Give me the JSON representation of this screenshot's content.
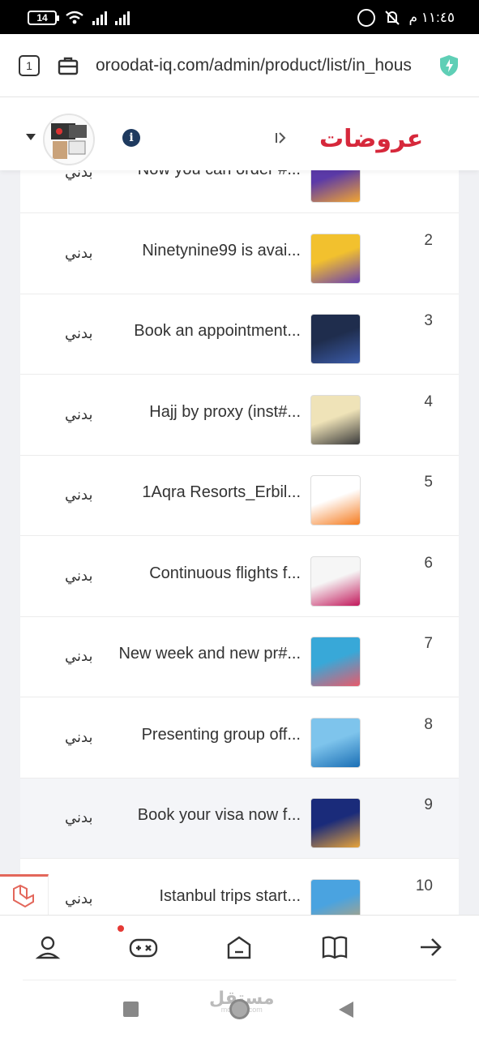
{
  "status_bar": {
    "battery": "14",
    "time": "١١:٤٥ م"
  },
  "browser": {
    "tab_count": "1",
    "url": "oroodat-iq.com/admin/product/list/in_hous"
  },
  "app": {
    "logo_text": "عروضات",
    "brand_color": "#d6283b"
  },
  "products": [
    {
      "num": "",
      "title": "Now you can order #...",
      "category": "بدني",
      "thumb_colors": [
        "#5b3aa8",
        "#f2a531"
      ]
    },
    {
      "num": "2",
      "title": "Ninetynine99 is avai...",
      "category": "بدني",
      "thumb_colors": [
        "#f2c12e",
        "#6a3fb0"
      ]
    },
    {
      "num": "3",
      "title": "Book an appointment...",
      "category": "بدني",
      "thumb_colors": [
        "#1f2d4d",
        "#3b5ba8"
      ]
    },
    {
      "num": "4",
      "title": "Hajj by proxy (inst#...",
      "category": "بدني",
      "thumb_colors": [
        "#efe3b8",
        "#3a3a3a"
      ]
    },
    {
      "num": "5",
      "title": "1Aqra Resorts_Erbil...",
      "category": "بدني",
      "thumb_colors": [
        "#ffffff",
        "#f57c20"
      ]
    },
    {
      "num": "6",
      "title": "Continuous flights f...",
      "category": "بدني",
      "thumb_colors": [
        "#f6f6f6",
        "#c2185b"
      ]
    },
    {
      "num": "7",
      "title": "New week and new pr#...",
      "category": "بدني",
      "thumb_colors": [
        "#38a8d8",
        "#e85a6b"
      ]
    },
    {
      "num": "8",
      "title": "Presenting group off...",
      "category": "بدني",
      "thumb_colors": [
        "#7ec4ec",
        "#1b6fb5"
      ]
    },
    {
      "num": "9",
      "title": "Book your visa now f...",
      "category": "بدني",
      "thumb_colors": [
        "#1a2b7a",
        "#e8a43a"
      ]
    },
    {
      "num": "10",
      "title": "Istanbul trips start...",
      "category": "بدني",
      "thumb_colors": [
        "#4aa3e0",
        "#c9a36a"
      ]
    }
  ],
  "watermark": {
    "text": "مستقل",
    "sub": "mostaql.com"
  }
}
